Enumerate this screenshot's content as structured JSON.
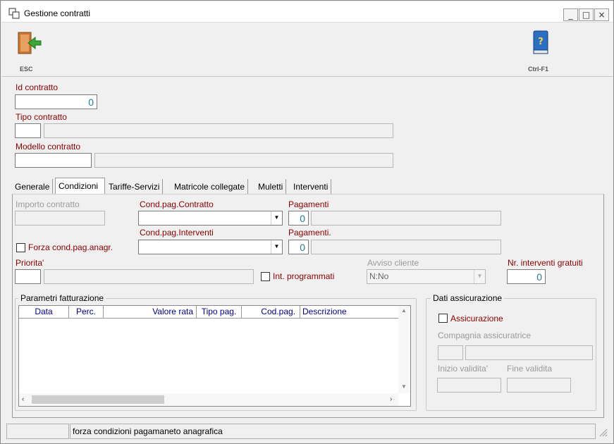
{
  "window": {
    "title": "Gestione contratti",
    "minimize": "_",
    "maximize": "□",
    "close": "×"
  },
  "toolbar": {
    "esc_label": "ESC",
    "help_label": "Ctrl-F1"
  },
  "header": {
    "id_label": "Id contratto",
    "id_value": "0",
    "tipo_label": "Tipo contratto",
    "modello_label": "Modello contratto"
  },
  "tabs": [
    {
      "label": "Generale"
    },
    {
      "label": "Condizioni"
    },
    {
      "label": "Tariffe-Servizi"
    },
    {
      "label": "Matricole collegate"
    },
    {
      "label": "Muletti"
    },
    {
      "label": "Interventi"
    }
  ],
  "conditions": {
    "importo_label": "Importo contratto",
    "cond_contratto_label": "Cond.pag.Contratto",
    "pagamenti_label": "Pagamenti",
    "pagamenti_value": "0",
    "cond_interventi_label": "Cond.pag.Interventi",
    "pagamenti2_label": "Pagamenti.",
    "pagamenti2_value": "0",
    "forza_label": "Forza cond.pag.anagr.",
    "priorita_label": "Priorita'",
    "int_programmati_label": "Int. programmati",
    "avviso_label": "Avviso cliente",
    "avviso_value": "N:No",
    "nr_interventi_label": "Nr. interventi gratuiti",
    "nr_interventi_value": "0"
  },
  "fatturazione": {
    "title": "Parametri fatturazione",
    "columns": [
      "Data",
      "Perc.",
      "Valore rata",
      "Tipo pag.",
      "Cod.pag.",
      "Descrizione"
    ]
  },
  "assicurazione": {
    "title": "Dati assicurazione",
    "check_label": "Assicurazione",
    "compagnia_label": "Compagnia assicuratrice",
    "inizio_label": "Inizio validita'",
    "fine_label": "Fine validita"
  },
  "statusbar": {
    "message": "forza condizioni pagamaneto anagrafica"
  }
}
